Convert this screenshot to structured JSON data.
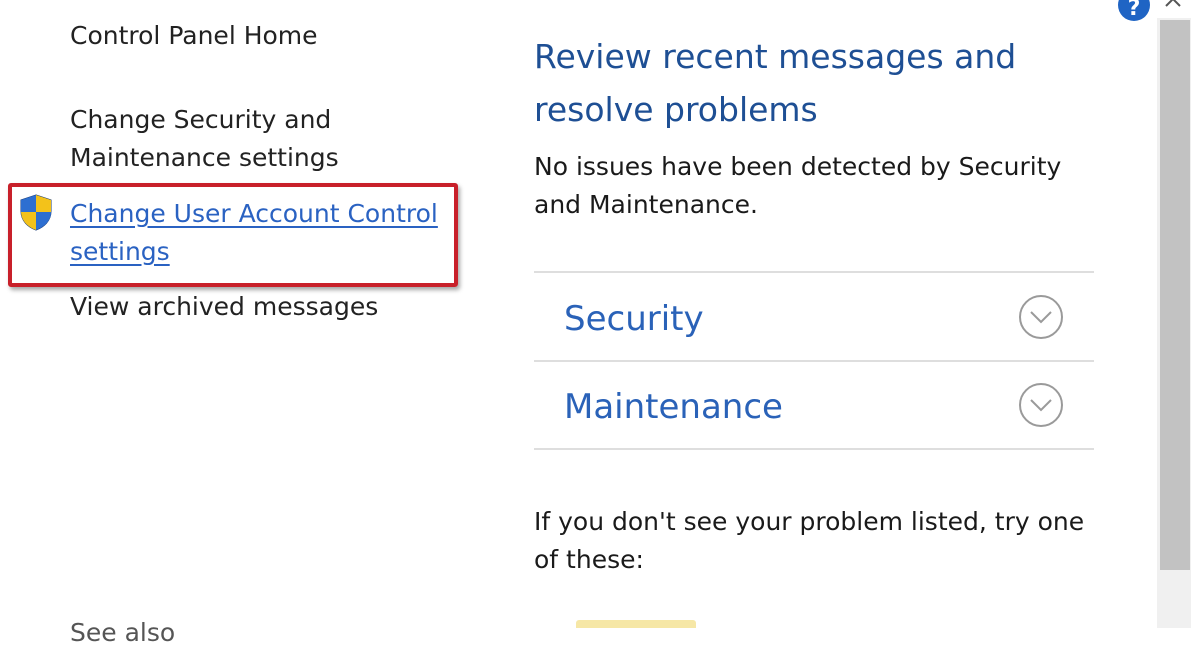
{
  "nav": {
    "home": "Control Panel Home",
    "security_settings": "Change Security and Maintenance settings",
    "uac_settings": "Change User Account Control settings",
    "archived": "View archived messages",
    "see_also": "See also"
  },
  "main": {
    "title": "Review recent messages and resolve problems",
    "status": "No issues have been detected by Security and Maintenance.",
    "sections": [
      {
        "label": "Security"
      },
      {
        "label": "Maintenance"
      }
    ],
    "suggest": "If you don't see your problem listed, try one of these:"
  },
  "colors": {
    "link": "#2a62c2",
    "title": "#1e4f94",
    "highlight": "#c8202a"
  },
  "icons": {
    "shield": "uac-shield-icon",
    "expand": "chevron-down-circle-icon",
    "help": "help-icon",
    "close": "close-icon"
  }
}
